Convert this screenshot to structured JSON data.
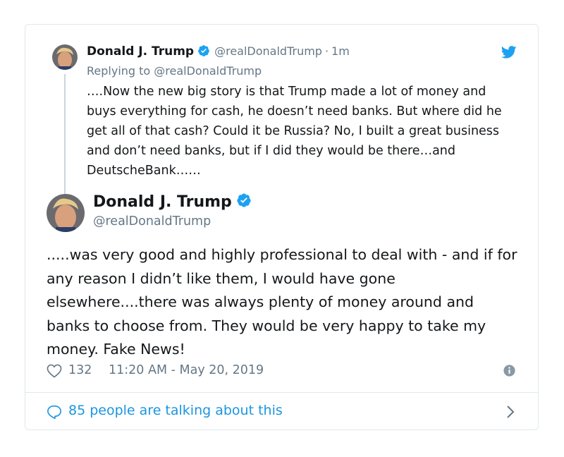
{
  "quoted_tweet": {
    "author_name": "Donald J. Trump",
    "handle": "@realDonaldTrump",
    "separator": "·",
    "time_ago": "1m",
    "replying_to": "Replying to @realDonaldTrump",
    "text": "….Now the new big story is that Trump made a lot of money and buys everything for cash, he doesn’t need banks. But where did he get all of that cash? Could it be Russia? No, I built a great business and don’t need banks, but if I did they would be there…and DeutscheBank……"
  },
  "main_tweet": {
    "author_name": "Donald J. Trump",
    "handle": "@realDonaldTrump",
    "text": ".....was very good and highly professional to deal with - and if for any reason I didn’t like them, I would have gone elsewhere....there was always plenty of money around and banks to choose from. They would be very happy to take my money. Fake News!",
    "like_count": "132",
    "timestamp": "11:20 AM - May 20, 2019"
  },
  "footer": {
    "talking_label": "85 people are talking about this"
  },
  "colors": {
    "accent": "#1da1f2",
    "link": "#1b95e0",
    "muted": "#657786",
    "border": "#e1e8ed"
  },
  "icons": [
    "verified-badge-icon",
    "twitter-bird-icon",
    "heart-icon",
    "info-icon",
    "chat-bubble-icon",
    "chevron-right-icon"
  ]
}
